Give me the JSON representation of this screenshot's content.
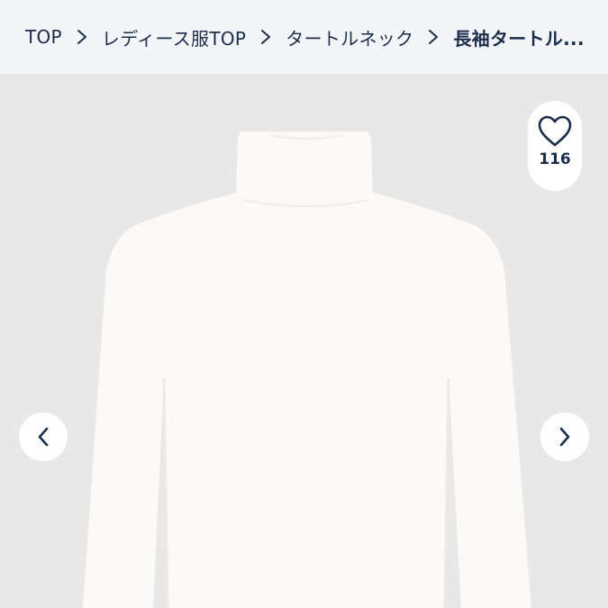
{
  "breadcrumb": {
    "items": [
      {
        "label": "TOP"
      },
      {
        "label": "レディース服TOP"
      },
      {
        "label": "タートルネック"
      },
      {
        "label": "長袖タートル..."
      }
    ]
  },
  "favorite": {
    "icon": "heart-icon",
    "count": "116"
  },
  "gallery": {
    "prev_icon": "chevron-left-icon",
    "next_icon": "chevron-right-icon"
  },
  "colors": {
    "breadcrumb_bg": "#f4f5f8",
    "text": "#1b2d4c",
    "photo_bg": "#e9e8e8",
    "garment": "#fbfaf7"
  }
}
